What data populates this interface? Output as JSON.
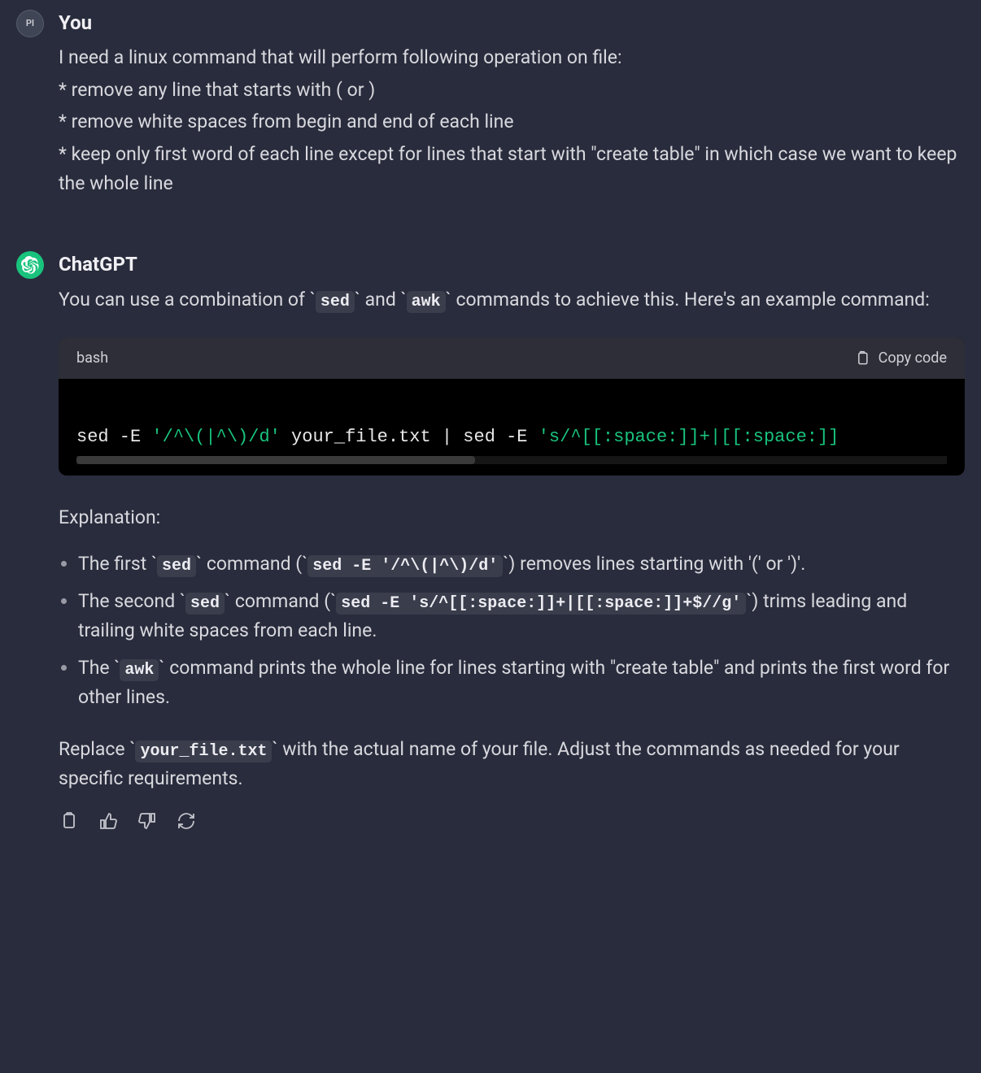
{
  "messages": {
    "user": {
      "avatar_initials": "PI",
      "sender": "You",
      "body_lines": [
        "I need a linux command that will perform following operation on file:",
        "* remove any line that starts with ( or )",
        "* remove white spaces from begin and end of each line",
        "* keep only first word of each line except for lines that start with \"create table\" in which case we want to keep the whole line"
      ]
    },
    "assistant": {
      "sender": "ChatGPT",
      "intro_pre": "You can use a combination of ",
      "intro_tick1": "sed",
      "intro_mid": " and ",
      "intro_tick2": "awk",
      "intro_post": " commands to achieve this. Here's an example command:",
      "code": {
        "lang": "bash",
        "copy_label": "Copy code",
        "seg1": "sed -E ",
        "seg2_str": "'/^\\(|^\\)/d'",
        "seg3": " your_file.txt | sed -E ",
        "seg4_str": "'s/^[[:space:]]+|[[:space:]]"
      },
      "explanation_label": "Explanation:",
      "bullets": {
        "b1": {
          "t1": "The first ",
          "c1": "sed",
          "t2": " command (",
          "c2": "sed -E '/^\\(|^\\)/d'",
          "t3": ") removes lines starting with '(' or ')'."
        },
        "b2": {
          "t1": "The second ",
          "c1": "sed",
          "t2": " command (",
          "c2": "sed -E 's/^[[:space:]]+|[[:space:]]+$//g'",
          "t3": ") trims leading and trailing white spaces from each line."
        },
        "b3": {
          "t1": "The ",
          "c1": "awk",
          "t2": " command prints the whole line for lines starting with \"create table\" and prints the first word for other lines."
        }
      },
      "outro_pre": "Replace ",
      "outro_code": "your_file.txt",
      "outro_post": " with the actual name of your file. Adjust the commands as needed for your specific requirements."
    }
  }
}
